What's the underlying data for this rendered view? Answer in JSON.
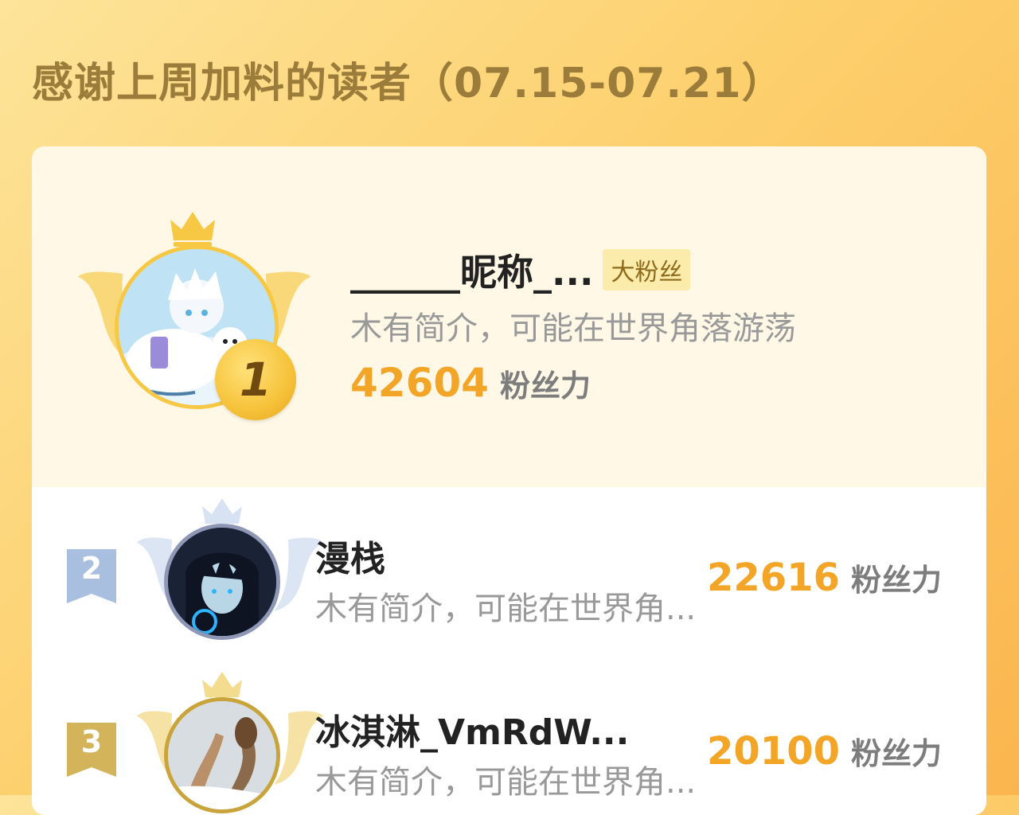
{
  "header": {
    "title": "感谢上周加料的读者（07.15-07.21）"
  },
  "leaderboard": [
    {
      "rank": "1",
      "name": "______昵称_...",
      "badge": "大粉丝",
      "bio": "木有简介，可能在世界角落游荡",
      "score": "42604",
      "unit": "粉丝力"
    },
    {
      "rank": "2",
      "name": "漫栈",
      "bio": "木有简介，可能在世界角...",
      "score": "22616",
      "unit": "粉丝力"
    },
    {
      "rank": "3",
      "name": "冰淇淋_VmRdW...",
      "bio": "木有简介，可能在世界角...",
      "score": "20100",
      "unit": "粉丝力"
    }
  ],
  "colors": {
    "score": "#f2a526",
    "gold": "#f7c843",
    "silver": "#9fb4d8",
    "bronze": "#d4b45a",
    "title": "#9c7c3a"
  },
  "icons": [
    "crown-icon",
    "wings-icon",
    "rank-flag-icon",
    "rank-medal-icon"
  ]
}
